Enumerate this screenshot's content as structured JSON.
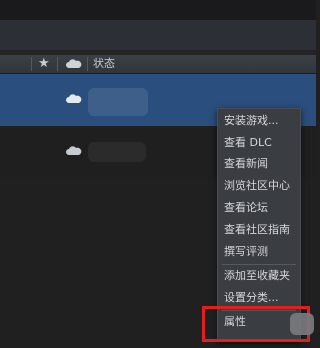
{
  "column_header": {
    "star_icon": "star-icon",
    "cloud_icon": "cloud-icon",
    "status_label": "状态"
  },
  "context_menu": {
    "items": [
      "安装游戏...",
      "查看 DLC",
      "查看新闻",
      "浏览社区中心",
      "查看论坛",
      "查看社区指南",
      "撰写评测",
      "添加至收藏夹",
      "设置分类...",
      "属性"
    ]
  },
  "colors": {
    "selected_row": "#2a4e7d",
    "menu_bg": "#3a3d42",
    "highlight_box": "#e0201e"
  }
}
